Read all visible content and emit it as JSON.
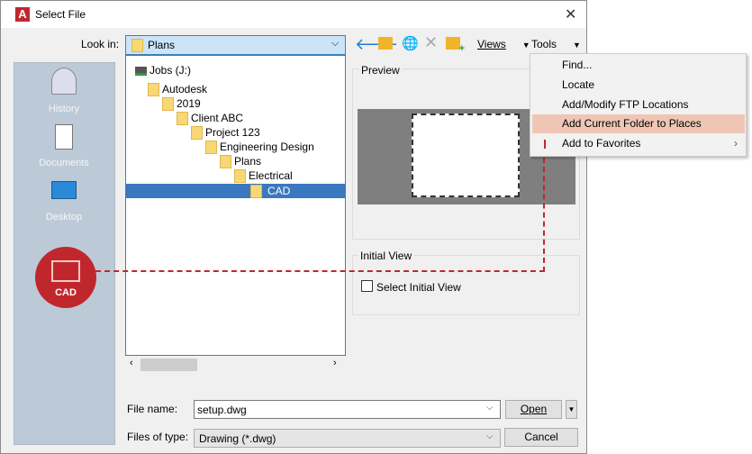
{
  "window": {
    "title": "Select File",
    "close": "✕"
  },
  "toolbar": {
    "look_in_label": "Look in:",
    "look_in_value": "Plans",
    "views_label": "Views",
    "tools_label": "Tools"
  },
  "places": [
    {
      "label": "History"
    },
    {
      "label": "Documents"
    },
    {
      "label": "Desktop"
    }
  ],
  "callout": {
    "label": "CAD",
    "color": "#c0272d"
  },
  "tree": [
    {
      "label": "Jobs (J:)"
    },
    {
      "label": "Autodesk"
    },
    {
      "label": "2019"
    },
    {
      "label": "Client ABC"
    },
    {
      "label": "Project 123"
    },
    {
      "label": "Engineering Design"
    },
    {
      "label": "Plans"
    },
    {
      "label": "Electrical"
    },
    {
      "label": "CAD",
      "selected": true
    }
  ],
  "preview": {
    "label": "Preview"
  },
  "initial_view": {
    "label": "Initial View",
    "checkbox_label": "Select Initial View",
    "checked": false
  },
  "tools_menu": [
    {
      "label": "Find..."
    },
    {
      "label": "Locate"
    },
    {
      "label": "Add/Modify FTP Locations"
    },
    {
      "label": "Add Current Folder to Places",
      "highlighted": true
    },
    {
      "label": "Add to Favorites",
      "submenu": "›"
    }
  ],
  "file_name": {
    "label": "File name:",
    "value": "setup.dwg"
  },
  "file_type": {
    "label": "Files of type:",
    "value": "Drawing (*.dwg)"
  },
  "buttons": {
    "open": "Open",
    "cancel": "Cancel"
  }
}
